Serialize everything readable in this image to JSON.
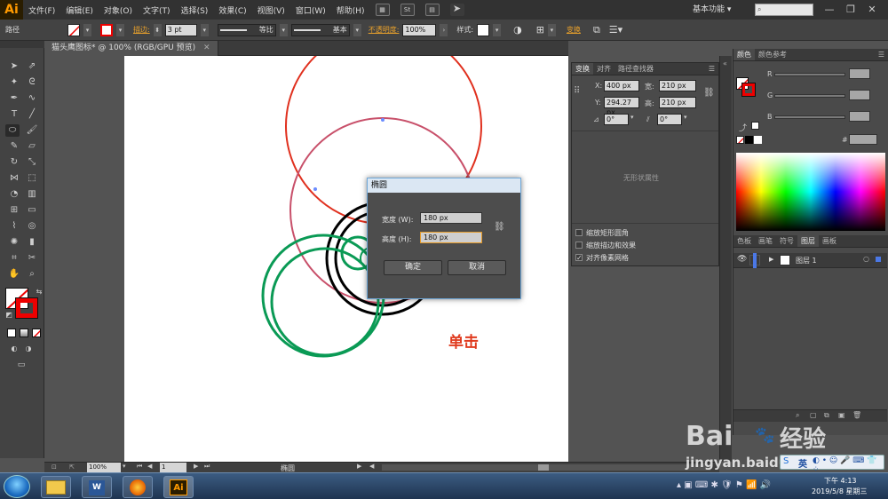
{
  "menubar": {
    "logo": "Ai",
    "items": [
      "文件(F)",
      "编辑(E)",
      "对象(O)",
      "文字(T)",
      "选择(S)",
      "效果(C)",
      "视图(V)",
      "窗口(W)",
      "帮助(H)"
    ],
    "workspace": "基本功能 ▾",
    "search_placeholder": "",
    "win_min": "—",
    "win_max": "❐",
    "win_close": "✕"
  },
  "controlbar": {
    "object_type": "路径",
    "stroke_label": "描边:",
    "stroke_value": "3 pt",
    "profile_label": "等比",
    "brush_label": "基本",
    "opacity_label": "不透明度:",
    "opacity_value": "100%",
    "style_label": "样式:",
    "transform_label": "变换"
  },
  "document": {
    "tab_title": "猫头鹰图标* @ 100% (RGB/GPU 预览)",
    "tab_close": "✕"
  },
  "annotation": {
    "text": "单击",
    "color": "#e03a1e"
  },
  "transform_panel": {
    "tabs": [
      "变换",
      "对齐",
      "路径查找器"
    ],
    "x_label": "X:",
    "x_value": "400 px",
    "y_label": "Y:",
    "y_value": "294.27 px",
    "w_label": "宽:",
    "w_value": "210 px",
    "h_label": "高:",
    "h_value": "210 px",
    "rotate_value": "0°",
    "shear_value": "0°",
    "no_shape_text": "无形状属性",
    "options": [
      {
        "label": "缩放矩形圆角",
        "checked": false
      },
      {
        "label": "缩放描边和效果",
        "checked": false
      },
      {
        "label": "对齐像素网格",
        "checked": true
      }
    ]
  },
  "color_panel": {
    "tabs": [
      "颜色",
      "颜色参考"
    ],
    "r_label": "R",
    "g_label": "G",
    "b_label": "B",
    "hex_label": "#"
  },
  "layers_panel": {
    "tabs": [
      "色板",
      "画笔",
      "符号",
      "图层",
      "画板"
    ],
    "layer_name": "图层 1"
  },
  "statusbar": {
    "zoom": "100%",
    "page": "1",
    "tool_name": "椭圆"
  },
  "dialog": {
    "title": "椭圆",
    "width_label": "宽度 (W):",
    "width_value": "180 px",
    "height_label": "高度 (H):",
    "height_value": "180 px",
    "ok_label": "确定",
    "cancel_label": "取消"
  },
  "taskbar": {
    "lang": "英",
    "time": "下午 4:13",
    "date": "2019/5/8 星期三"
  },
  "watermark": {
    "brand": "Bai",
    "brand_cn": "经验",
    "url": "jingyan.baidu.com"
  },
  "colors": {
    "accent_orange": "#ff9a00",
    "red_circle": "#e0301e",
    "green_circle": "#0a9a55",
    "black_circle": "#000000",
    "selection_path": "#c8506a"
  }
}
